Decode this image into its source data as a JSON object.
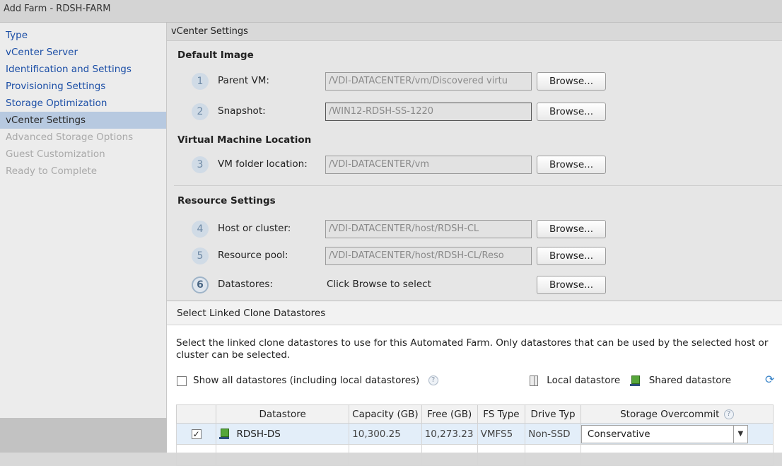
{
  "window": {
    "title": "Add Farm - RDSH-FARM"
  },
  "sidebar": {
    "items": [
      {
        "label": "Type",
        "state": "link"
      },
      {
        "label": "vCenter Server",
        "state": "link"
      },
      {
        "label": "Identification and Settings",
        "state": "link"
      },
      {
        "label": "Provisioning Settings",
        "state": "link"
      },
      {
        "label": "Storage Optimization",
        "state": "link"
      },
      {
        "label": "vCenter Settings",
        "state": "current"
      },
      {
        "label": "Advanced Storage Options",
        "state": "disabled"
      },
      {
        "label": "Guest Customization",
        "state": "disabled"
      },
      {
        "label": "Ready to Complete",
        "state": "disabled"
      }
    ]
  },
  "main": {
    "section_title": "vCenter Settings",
    "browse_label": "Browse...",
    "groups": {
      "default_image": "Default Image",
      "vm_location": "Virtual Machine Location",
      "resource_settings": "Resource Settings"
    },
    "steps": [
      {
        "num": "1",
        "label": "Parent VM:",
        "value": "/VDI-DATACENTER/vm/Discovered virtu"
      },
      {
        "num": "2",
        "label": "Snapshot:",
        "value": "/WIN12-RDSH-SS-1220"
      },
      {
        "num": "3",
        "label": "VM folder location:",
        "value": "/VDI-DATACENTER/vm"
      },
      {
        "num": "4",
        "label": "Host or cluster:",
        "value": "/VDI-DATACENTER/host/RDSH-CL"
      },
      {
        "num": "5",
        "label": "Resource pool:",
        "value": "/VDI-DATACENTER/host/RDSH-CL/Reso"
      },
      {
        "num": "6",
        "label": "Datastores:",
        "value": "Click Browse to select"
      }
    ]
  },
  "dialog": {
    "title": "Select Linked Clone Datastores",
    "description": "Select the linked clone datastores to use for this Automated Farm. Only datastores that can be used by the selected host or cluster can be selected.",
    "show_all_label": "Show all datastores (including local datastores)",
    "help_glyph": "?",
    "legend_local": "Local datastore",
    "legend_shared": "Shared datastore",
    "table": {
      "headers": [
        "",
        "Datastore",
        "Capacity (GB)",
        "Free (GB)",
        "FS Type",
        "Drive Typ",
        "Storage Overcommit"
      ],
      "rows": [
        {
          "checked": "✓",
          "datastore": "RDSH-DS",
          "capacity": "10,300.25",
          "free": "10,273.23",
          "fs_type": "VMFS5",
          "drive_type": "Non-SSD",
          "overcommit": "Conservative"
        }
      ]
    }
  },
  "icons": {
    "local_datastore": "local-datastore-icon",
    "shared_datastore": "shared-datastore-icon",
    "refresh": "refresh-icon"
  },
  "colors": {
    "link": "#1b4ea6",
    "selected_nav": "#b7c9e0",
    "selected_row": "#e3eef9"
  }
}
